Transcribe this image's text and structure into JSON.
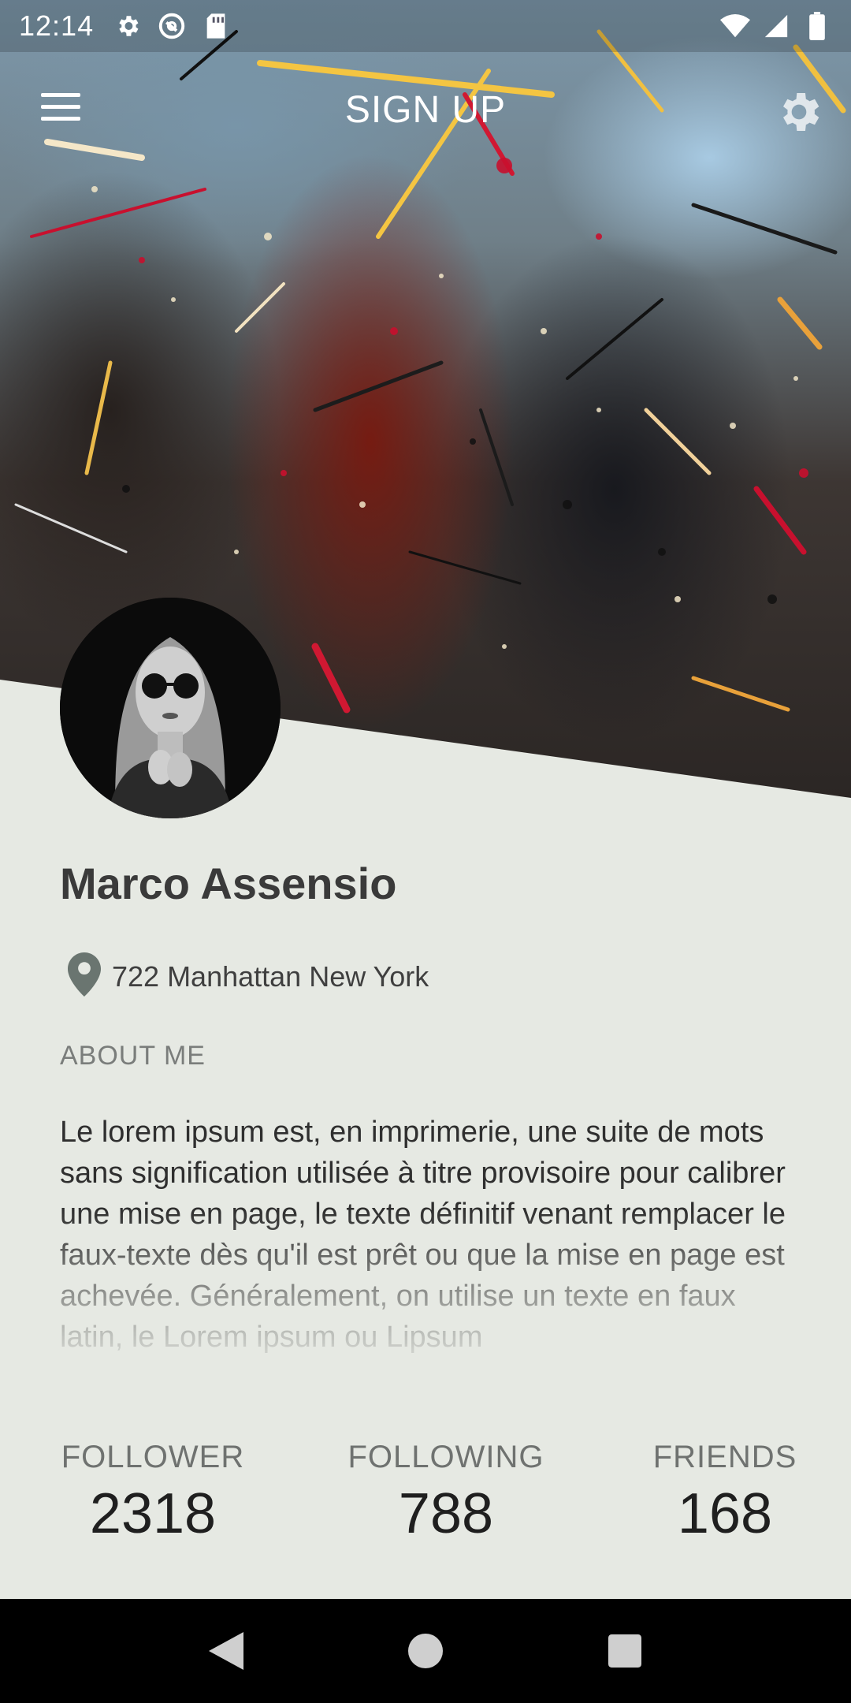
{
  "status_bar": {
    "time": "12:14",
    "left_icons": [
      "gear-icon",
      "at-icon",
      "sd-card-icon"
    ],
    "right_icons": [
      "wifi-icon",
      "signal-icon",
      "battery-icon"
    ]
  },
  "app_bar": {
    "title": "SIGN UP",
    "menu_icon": "hamburger-menu-icon",
    "settings_icon": "gear-icon"
  },
  "profile": {
    "name": "Marco Assensio",
    "location": "722 Manhattan New York",
    "about_heading": "ABOUT ME",
    "about_text": "Le lorem ipsum est, en imprimerie, une suite de mots sans signification utilisée à titre provisoire pour calibrer une mise en page, le texte définitif venant remplacer le faux-texte dès qu'il est prêt ou que la mise en page est achevée. Généralement, on utilise un texte en faux latin, le Lorem ipsum ou Lipsum"
  },
  "stats": [
    {
      "label": "FOLLOWER",
      "value": "2318"
    },
    {
      "label": "FOLLOWING",
      "value": "788"
    },
    {
      "label": "FRIENDS",
      "value": "168"
    }
  ],
  "colors": {
    "page_background": "#e6e9e3",
    "name_text": "#3a3a3a",
    "pin_icon": "#6a7570"
  },
  "nav_bar": [
    "back-icon",
    "home-icon",
    "recents-icon"
  ]
}
